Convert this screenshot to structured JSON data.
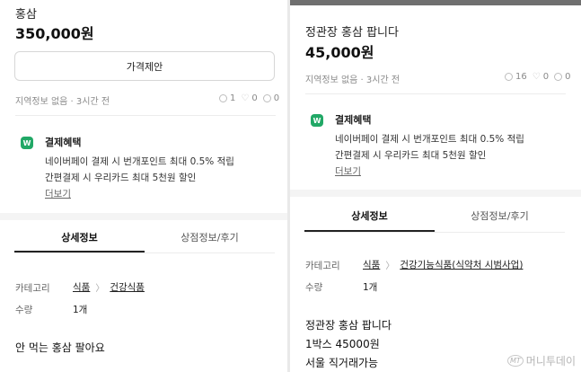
{
  "left": {
    "title": "홍삼",
    "price": "350,000원",
    "offer_button": "가격제안",
    "meta": "지역정보 없음 · 3시간 전",
    "stats": {
      "views": "1",
      "likes": "0",
      "chats": "0"
    },
    "benefit": {
      "title": "결제혜택",
      "icon": "naverpay-icon",
      "line1": "네이버페이 결제 시 번개포인트 최대 0.5% 적립",
      "line2": "간편결제 시 우리카드 최대 5천원 할인",
      "more": "더보기"
    },
    "tabs": [
      "상세정보",
      "상점정보/후기"
    ],
    "category_label": "카테고리",
    "category": [
      "식품",
      "건강식품"
    ],
    "quantity_label": "수량",
    "quantity": "1개",
    "description": "안 먹는 홍삼 팔아요"
  },
  "right": {
    "title": "정관장 홍삼 팝니다",
    "price": "45,000원",
    "meta": "지역정보 없음 · 3시간 전",
    "stats": {
      "views": "16",
      "likes": "0",
      "chats": "0"
    },
    "benefit": {
      "title": "결제혜택",
      "icon": "naverpay-icon",
      "line1": "네이버페이 결제 시 번개포인트 최대 0.5% 적립",
      "line2": "간편결제 시 우리카드 최대 5천원 할인",
      "more": "더보기"
    },
    "tabs": [
      "상세정보",
      "상점정보/후기"
    ],
    "category_label": "카테고리",
    "category": [
      "식품",
      "건강기능식품(식약처 시범사업)"
    ],
    "quantity_label": "수량",
    "quantity": "1개",
    "description": [
      "정관장 홍삼 팝니다",
      "1박스 45000원",
      "서울 직거래가능"
    ]
  },
  "watermark": {
    "logo": "MT",
    "text": "머니투데이"
  },
  "colors": {
    "npay_green": "#21a866",
    "text": "#111111",
    "muted": "#8a8a8a"
  }
}
